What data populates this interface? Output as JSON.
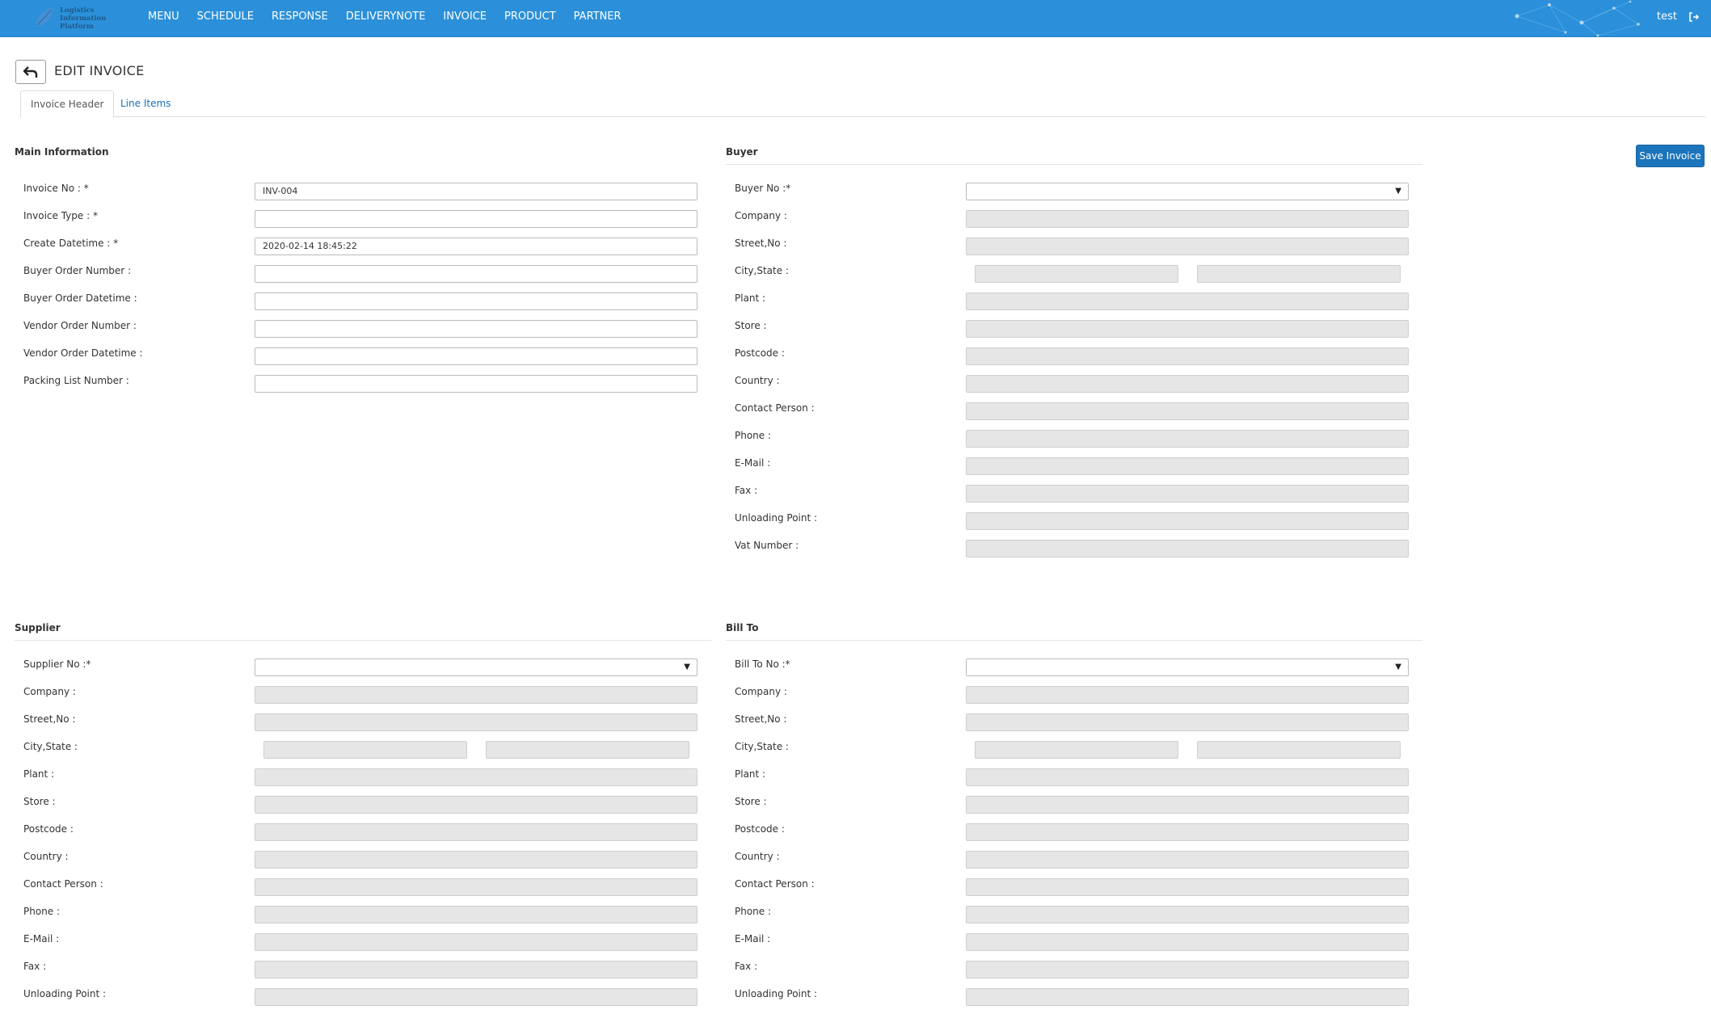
{
  "logo": {
    "line1": "Logistics",
    "line2": "Information",
    "line3": "Platform"
  },
  "nav": {
    "items": [
      "MENU",
      "SCHEDULE",
      "RESPONSE",
      "DELIVERYNOTE",
      "INVOICE",
      "PRODUCT",
      "PARTNER"
    ],
    "user": "test"
  },
  "header": {
    "title": "EDIT INVOICE",
    "save_label": "Save Invoice"
  },
  "tabs": [
    {
      "label": "Invoice Header"
    },
    {
      "label": "Line Items"
    }
  ],
  "main": {
    "title": "Main Information",
    "fields": [
      {
        "label": "Invoice No : *",
        "value": "INV-004"
      },
      {
        "label": "Invoice Type : *",
        "value": ""
      },
      {
        "label": "Create Datetime : *",
        "value": "2020-02-14 18:45:22"
      },
      {
        "label": "Buyer Order Number :",
        "value": ""
      },
      {
        "label": "Buyer Order Datetime :",
        "value": ""
      },
      {
        "label": "Vendor Order Number :",
        "value": ""
      },
      {
        "label": "Vendor Order Datetime :",
        "value": ""
      },
      {
        "label": "Packing List Number :",
        "value": ""
      }
    ]
  },
  "buyer": {
    "title": "Buyer",
    "fields": [
      "Buyer No :*",
      "Company :",
      "Street,No :",
      "City,State :",
      "Plant :",
      "Store :",
      "Postcode :",
      "Country :",
      "Contact Person :",
      "Phone :",
      "E-Mail :",
      "Fax :",
      "Unloading Point :",
      "Vat Number :"
    ]
  },
  "supplier": {
    "title": "Supplier",
    "fields": [
      "Supplier No :*",
      "Company :",
      "Street,No :",
      "City,State :",
      "Plant :",
      "Store :",
      "Postcode :",
      "Country :",
      "Contact Person :",
      "Phone :",
      "E-Mail :",
      "Fax :",
      "Unloading Point :"
    ]
  },
  "billto": {
    "title": "Bill To",
    "fields": [
      "Bill To No :*",
      "Company :",
      "Street,No :",
      "City,State :",
      "Plant :",
      "Store :",
      "Postcode :",
      "Country :",
      "Contact Person :",
      "Phone :",
      "E-Mail :",
      "Fax :",
      "Unloading Point :"
    ]
  },
  "colors": {
    "navbar": "#2b90d9",
    "save_button": "#1c75bc",
    "link": "#1a6fb8"
  }
}
